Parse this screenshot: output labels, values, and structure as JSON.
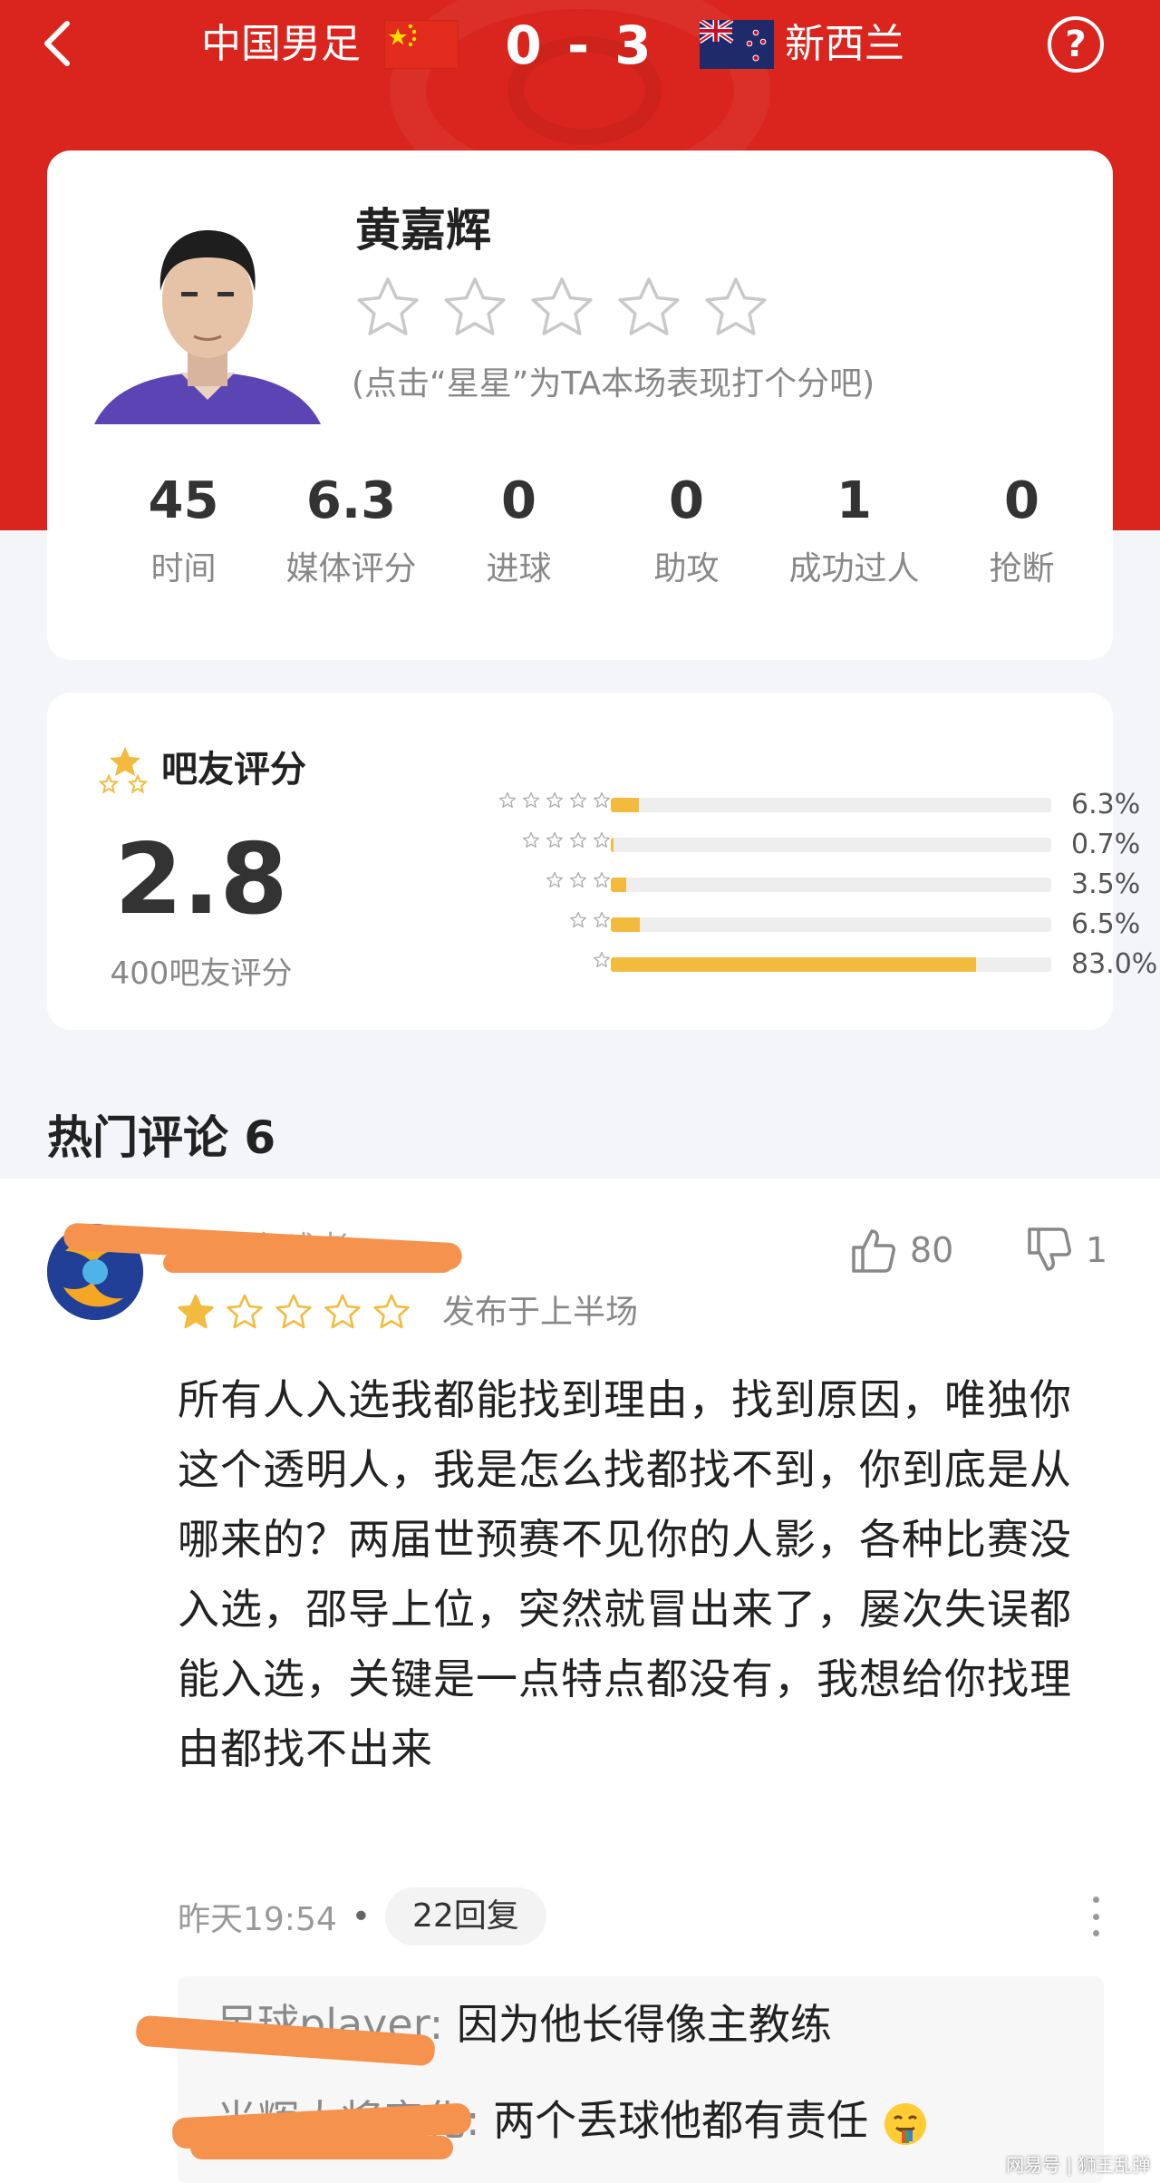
{
  "header": {
    "team_left": "中国男足",
    "score": "0 - 3",
    "team_right": "新西兰",
    "help_label": "?"
  },
  "player": {
    "name": "黄嘉辉",
    "rating_hint": "(点击“星星”为TA本场表现打个分吧)",
    "star_count_selectable": 5,
    "stats": [
      {
        "value": "45",
        "label": "时间"
      },
      {
        "value": "6.3",
        "label": "媒体评分"
      },
      {
        "value": "0",
        "label": "进球"
      },
      {
        "value": "0",
        "label": "助攻"
      },
      {
        "value": "1",
        "label": "成功过人"
      },
      {
        "value": "0",
        "label": "抢断"
      }
    ]
  },
  "fan_rating": {
    "title": "吧友评分",
    "average": "2.8",
    "count_text": "400吧友评分",
    "chart_data": {
      "type": "bar",
      "categories": [
        "5 stars",
        "4 stars",
        "3 stars",
        "2 stars",
        "1 star"
      ],
      "values": [
        6.3,
        0.7,
        3.5,
        6.5,
        83.0
      ],
      "value_labels": [
        "6.3%",
        "0.7%",
        "3.5%",
        "6.5%",
        "83.0%"
      ],
      "star_counts": [
        5,
        4,
        3,
        2,
        1
      ],
      "ylim": [
        0,
        100
      ],
      "bar_color": "#f3bb3e"
    }
  },
  "comments": {
    "title": "热门评论 6",
    "items": [
      {
        "username": "专业忠球者",
        "likes": "80",
        "dislikes": "1",
        "stars_filled": 1,
        "stars_total": 5,
        "posted": "发布于上半场",
        "text": "所有人入选我都能找到理由，找到原因，唯独你这个透明人，我是怎么找都找不到，你到底是从哪来的？两届世预赛不见你的人影，各种比赛没入选，邵导上位，突然就冒出来了，屡次失误都能入选，关键是一点特点都没有，我想给你找理由都找不出来",
        "time": "昨天19:54",
        "reply_count": "22回复",
        "replies": [
          {
            "user": "足球player:",
            "text": "因为他长得像主教练"
          },
          {
            "user": "光辉大将彦化:",
            "text": "两个丢球他都有责任"
          }
        ]
      }
    ]
  },
  "watermark": "网易号 | 狮王乱弹",
  "colors": {
    "brand_red": "#d9251d",
    "star_yellow": "#f3bb3e",
    "scribble_orange": "#f5934e"
  }
}
